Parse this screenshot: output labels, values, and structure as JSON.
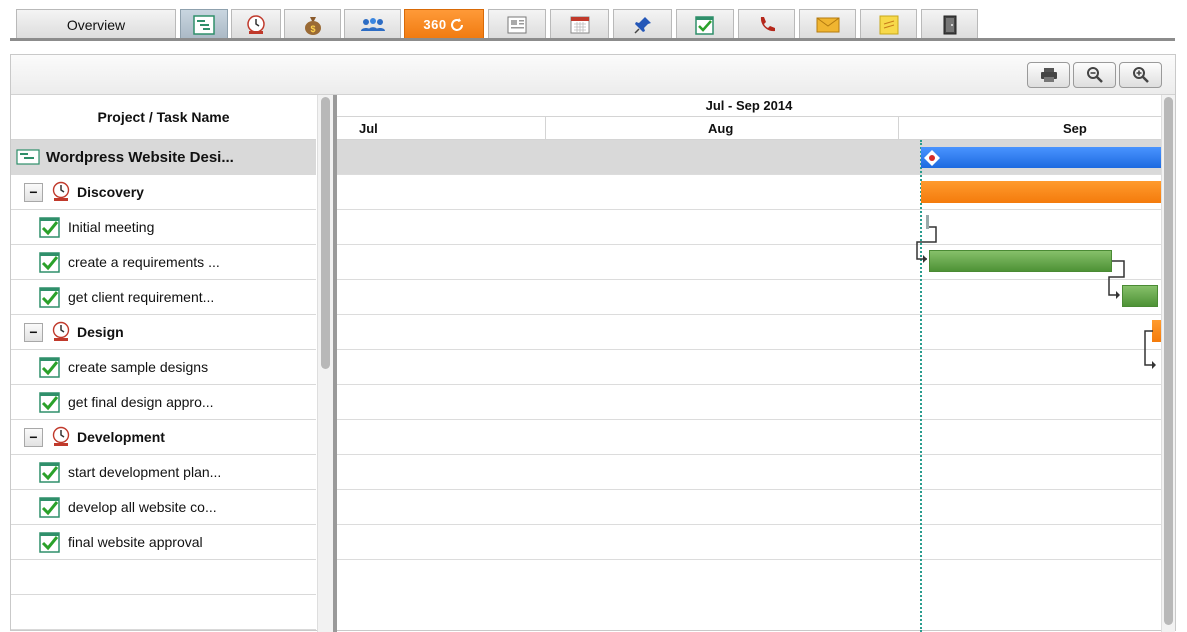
{
  "tabs": {
    "overview_label": "Overview",
    "tab_360_label": "360",
    "icons": [
      "gantt-icon",
      "task-icon",
      "money-bag-icon",
      "team-icon",
      "360-icon",
      "document-icon",
      "calendar-icon",
      "pin-icon",
      "checklist-icon",
      "phone-icon",
      "mail-icon",
      "note-icon",
      "door-icon"
    ]
  },
  "toolbar": {
    "print_icon": "printer-icon",
    "zoom_out_icon": "zoom-out-icon",
    "zoom_in_icon": "zoom-in-icon"
  },
  "grid": {
    "header": "Project / Task Name",
    "project": "Wordpress Website Desi...",
    "rows": [
      {
        "type": "group",
        "label": "Discovery"
      },
      {
        "type": "task",
        "label": "Initial meeting"
      },
      {
        "type": "task",
        "label": "create a requirements ..."
      },
      {
        "type": "task",
        "label": "get client requirement..."
      },
      {
        "type": "group",
        "label": "Design"
      },
      {
        "type": "task",
        "label": "create sample designs"
      },
      {
        "type": "task",
        "label": "get final design appro..."
      },
      {
        "type": "group",
        "label": "Development"
      },
      {
        "type": "task",
        "label": "start development plan..."
      },
      {
        "type": "task",
        "label": "develop all website co..."
      },
      {
        "type": "task",
        "label": "final website approval"
      }
    ],
    "collapse_symbol": "−"
  },
  "gantt": {
    "period": "Jul - Sep 2014",
    "months": [
      "Jul",
      "Aug",
      "Sep"
    ],
    "colors": {
      "project_bar": "#2b7bf0",
      "group_bar": "#f7870f",
      "task_bar": "#5a9e40",
      "today_line": "#2a9d8f"
    }
  }
}
